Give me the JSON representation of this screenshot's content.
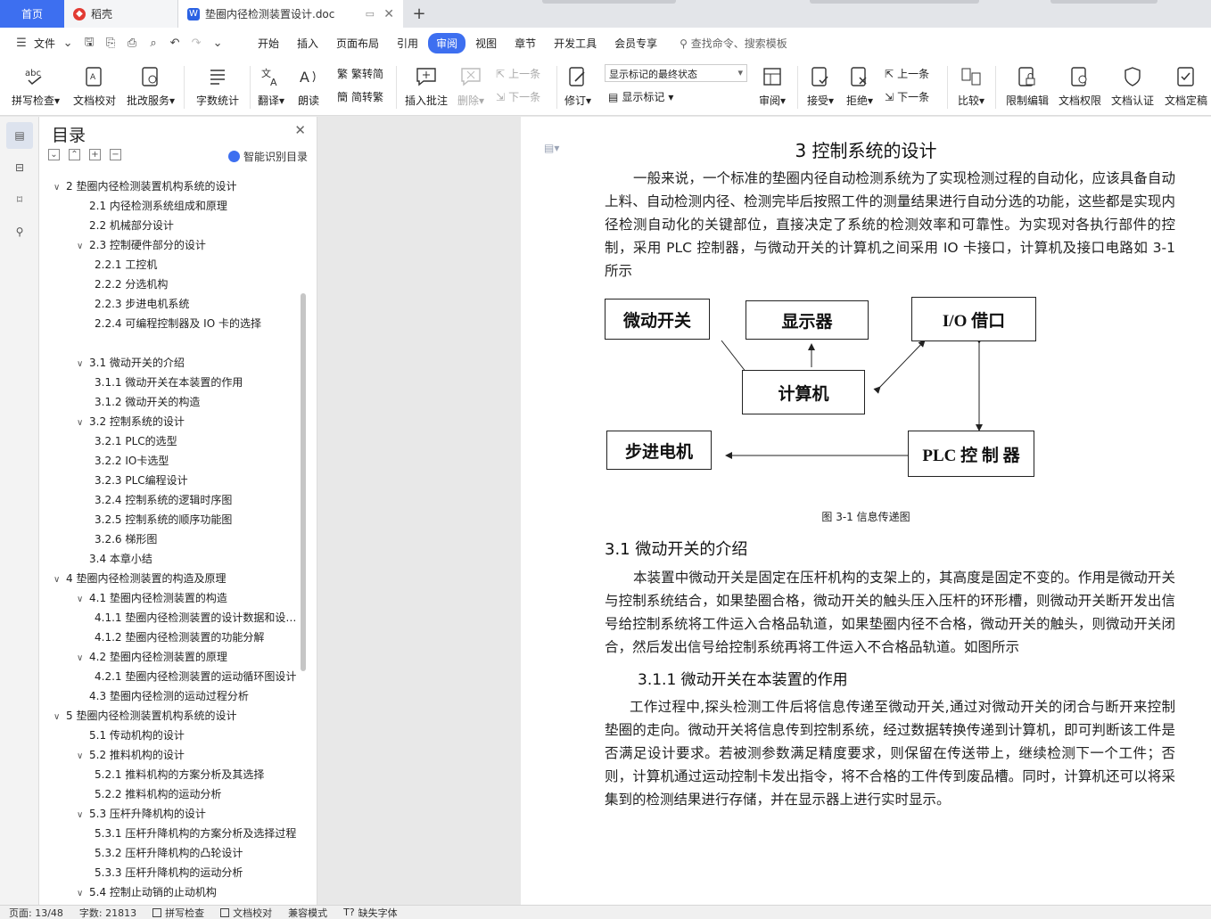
{
  "tabs": {
    "home": "首页",
    "daoke": "稻壳",
    "doc": "垫圈内径检测装置设计.doc",
    "new_tab": "+"
  },
  "menu": {
    "file": "文件",
    "items": [
      "开始",
      "插入",
      "页面布局",
      "引用",
      "审阅",
      "视图",
      "章节",
      "开发工具",
      "会员专享"
    ],
    "active": "审阅",
    "search": "查找命令、搜索模板"
  },
  "ribbon": {
    "spell": "拼写检查",
    "proof": "文档校对",
    "annotate": "批改服务",
    "wordcount": "字数统计",
    "translate": "翻译",
    "read": "朗读",
    "to_trad": "繁转简",
    "to_simp": "简转繁",
    "insert_comment": "插入批注",
    "delete": "删除",
    "prev_comment": "上一条",
    "next_comment": "下一条",
    "revise": "修订",
    "markup_state": "显示标记的最终状态",
    "show_markup": "显示标记",
    "review": "审阅",
    "accept": "接受",
    "reject": "拒绝",
    "prev_change": "上一条",
    "next_change": "下一条",
    "compare": "比较",
    "restrict": "限制编辑",
    "permission": "文档权限",
    "certify": "文档认证",
    "finalize": "文档定稿"
  },
  "toc": {
    "title": "目录",
    "smart": "智能识别目录",
    "items": [
      {
        "arrow": "∨",
        "indent": 0,
        "text": "2   垫圈内径检测装置机构系统的设计"
      },
      {
        "arrow": "",
        "indent": 1,
        "text": "2.1    内径检测系统组成和原理"
      },
      {
        "arrow": "",
        "indent": 1,
        "text": "2.2    机械部分设计"
      },
      {
        "arrow": "∨",
        "indent": 1,
        "text": "2.3    控制硬件部分的设计"
      },
      {
        "arrow": "",
        "indent": 2,
        "text": "2.2.1    工控机"
      },
      {
        "arrow": "",
        "indent": 2,
        "text": "2.2.2    分选机构"
      },
      {
        "arrow": "",
        "indent": 2,
        "text": "2.2.3    步进电机系统"
      },
      {
        "arrow": "",
        "indent": 2,
        "text": "2.2.4    可编程控制器及  IO  卡的选择"
      },
      {
        "arrow": "∨",
        "indent": 0,
        "text": "3   控制系统的设计",
        "selected": true
      },
      {
        "arrow": "∨",
        "indent": 1,
        "text": "3.1    微动开关的介绍"
      },
      {
        "arrow": "",
        "indent": 2,
        "text": "3.1.1    微动开关在本装置的作用"
      },
      {
        "arrow": "",
        "indent": 2,
        "text": "3.1.2    微动开关的构造"
      },
      {
        "arrow": "∨",
        "indent": 1,
        "text": "3.2    控制系统的设计"
      },
      {
        "arrow": "",
        "indent": 2,
        "text": "3.2.1    PLC的选型"
      },
      {
        "arrow": "",
        "indent": 2,
        "text": "3.2.2    IO卡选型"
      },
      {
        "arrow": "",
        "indent": 2,
        "text": "3.2.3    PLC编程设计"
      },
      {
        "arrow": "",
        "indent": 2,
        "text": "3.2.4    控制系统的逻辑时序图"
      },
      {
        "arrow": "",
        "indent": 2,
        "text": "3.2.5    控制系统的顺序功能图"
      },
      {
        "arrow": "",
        "indent": 2,
        "text": "3.2.6    梯形图"
      },
      {
        "arrow": "",
        "indent": 1,
        "text": "3.4    本章小结"
      },
      {
        "arrow": "∨",
        "indent": 0,
        "text": "4   垫圈内径检测装置的构造及原理"
      },
      {
        "arrow": "∨",
        "indent": 1,
        "text": "4.1    垫圈内径检测装置的构造"
      },
      {
        "arrow": "",
        "indent": 2,
        "text": "4.1.1    垫圈内径检测装置的设计数据和设计要求"
      },
      {
        "arrow": "",
        "indent": 2,
        "text": "4.1.2    垫圈内径检测装置的功能分解"
      },
      {
        "arrow": "∨",
        "indent": 1,
        "text": "4.2    垫圈内径检测装置的原理"
      },
      {
        "arrow": "",
        "indent": 2,
        "text": "4.2.1    垫圈内径检测装置的运动循环图设计"
      },
      {
        "arrow": "",
        "indent": 1,
        "text": "4.3    垫圈内径检测的运动过程分析"
      },
      {
        "arrow": "∨",
        "indent": 0,
        "text": "5   垫圈内径检测装置机构系统的设计"
      },
      {
        "arrow": "",
        "indent": 1,
        "text": "5.1    传动机构的设计"
      },
      {
        "arrow": "∨",
        "indent": 1,
        "text": "5.2    推料机构的设计"
      },
      {
        "arrow": "",
        "indent": 2,
        "text": "5.2.1    推料机构的方案分析及其选择"
      },
      {
        "arrow": "",
        "indent": 2,
        "text": "5.2.2    推料机构的运动分析"
      },
      {
        "arrow": "∨",
        "indent": 1,
        "text": "5.3    压杆升降机构的设计"
      },
      {
        "arrow": "",
        "indent": 2,
        "text": "5.3.1    压杆升降机构的方案分析及选择过程"
      },
      {
        "arrow": "",
        "indent": 2,
        "text": "5.3.2    压杆升降机构的凸轮设计"
      },
      {
        "arrow": "",
        "indent": 2,
        "text": "5.3.3    压杆升降机构的运动分析"
      },
      {
        "arrow": "∨",
        "indent": 1,
        "text": "5.4    控制止动销的止动机构"
      }
    ]
  },
  "document": {
    "title": "3   控制系统的设计",
    "para1": "一般来说，一个标准的垫圈内径自动检测系统为了实现检测过程的自动化，应该具备自动上料、自动检测内径、检测完毕后按照工件的测量结果进行自动分选的功能，这些都是实现内径检测自动化的关键部位，直接决定了系统的检测效率和可靠性。为实现对各执行部件的控制，采用 PLC 控制器，与微动开关的计算机之间采用 IO 卡接口，计算机及接口电路如 3-1 所示",
    "figure": {
      "microswitch": "微动开关",
      "display": "显示器",
      "io": "I/O 借口",
      "computer": "计算机",
      "stepper": "步进电机",
      "plc": "PLC  控 制 器",
      "caption": "图 3-1  信息传递图"
    },
    "h2": "3.1   微动开关的介绍",
    "para2": "本装置中微动开关是固定在压杆机构的支架上的，其高度是固定不变的。作用是微动开关与控制系统结合，如果垫圈合格，微动开关的触头压入压杆的环形槽，则微动开关断开发出信号给控制系统将工件运入合格品轨道，如果垫圈内径不合格，微动开关的触头，则微动开关闭合，然后发出信号给控制系统再将工件运入不合格品轨道。如图所示",
    "h3": "3.1.1   微动开关在本装置的作用",
    "para3": "工作过程中,探头检测工件后将信息传递至微动开关,通过对微动开关的闭合与断开来控制垫圈的走向。微动开关将信息传到控制系统，经过数据转换传递到计算机，即可判断该工件是否满足设计要求。若被测参数满足精度要求，则保留在传送带上，继续检测下一个工件；否则，计算机通过运动控制卡发出指令，将不合格的工件传到废品槽。同时，计算机还可以将采集到的检测结果进行存储，并在显示器上进行实时显示。"
  },
  "status": {
    "page": "页面: 13/48",
    "words": "字数: 21813",
    "spell": "拼写检查",
    "proof": "文档校对",
    "compat": "兼容模式",
    "missing_font": "缺失字体"
  }
}
